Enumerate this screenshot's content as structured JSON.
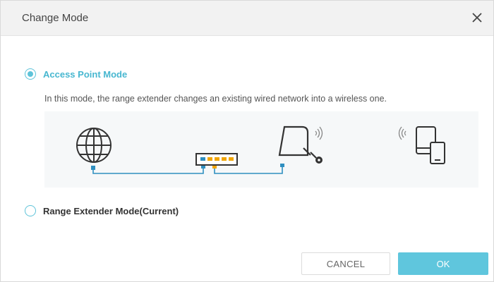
{
  "dialog": {
    "title": "Change Mode",
    "close_icon": "close-icon"
  },
  "options": [
    {
      "label": "Access Point Mode",
      "selected": true
    },
    {
      "label": "Range Extender Mode(Current)",
      "selected": false
    }
  ],
  "description": "In this mode, the range extender changes an existing wired network into a wireless one.",
  "diagram": {
    "icons": [
      "globe-icon",
      "switch-icon",
      "extender-icon",
      "wifi-signal-icon",
      "devices-icon"
    ]
  },
  "buttons": {
    "cancel_label": "CANCEL",
    "ok_label": "OK"
  },
  "colors": {
    "accent": "#5fc6dd",
    "header_bg": "#f2f2f2",
    "diagram_bg": "#f6f8f9"
  }
}
